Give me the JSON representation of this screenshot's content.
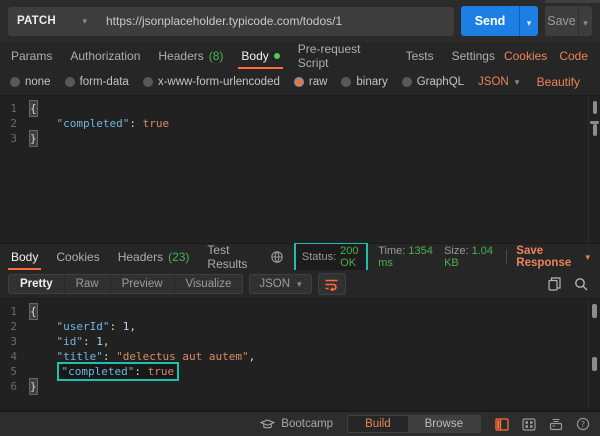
{
  "theme": {
    "accent_orange": "#ff6c37",
    "link_orange": "#ed835a",
    "success_green": "#4caf50",
    "highlight_teal": "#1dbfae",
    "send_blue": "#1d7fe4",
    "bg_dark": "#262626",
    "editor_bg": "#212121"
  },
  "request_bar": {
    "method": "PATCH",
    "url": "https://jsonplaceholder.typicode.com/todos/1",
    "send": "Send",
    "save": "Save"
  },
  "request_tabs": {
    "params": "Params",
    "authorization": "Authorization",
    "headers": "Headers",
    "headers_count": "(8)",
    "body": "Body",
    "prerequest": "Pre-request Script",
    "tests": "Tests",
    "settings": "Settings",
    "cookies": "Cookies",
    "code": "Code",
    "active_tab": "Body"
  },
  "body_options": {
    "none": "none",
    "form_data": "form-data",
    "urlencoded": "x-www-form-urlencoded",
    "raw": "raw",
    "binary": "binary",
    "graphql": "GraphQL",
    "format": "JSON",
    "beautify": "Beautify",
    "selected_mode": "raw"
  },
  "request_editor": {
    "lines": [
      {
        "num": "1",
        "tokens": [
          {
            "text": "{",
            "type": "punct"
          }
        ]
      },
      {
        "num": "2",
        "tokens": [
          {
            "text": "    ",
            "type": "ws"
          },
          {
            "text": "\"completed\"",
            "type": "key"
          },
          {
            "text": ": ",
            "type": "punct"
          },
          {
            "text": "true",
            "type": "bool"
          }
        ]
      },
      {
        "num": "3",
        "tokens": [
          {
            "text": "}",
            "type": "punct"
          }
        ]
      }
    ]
  },
  "response_tabs": {
    "body": "Body",
    "cookies": "Cookies",
    "headers": "Headers",
    "headers_count": "(23)",
    "test_results": "Test Results",
    "active_tab": "Body"
  },
  "response_meta": {
    "status_label": "Status:",
    "status_value": "200 OK",
    "time_label": "Time:",
    "time_value": "1354 ms",
    "size_label": "Size:",
    "size_value": "1.04 KB",
    "save_response": "Save Response"
  },
  "response_toolbar": {
    "pretty": "Pretty",
    "raw": "Raw",
    "preview": "Preview",
    "visualize": "Visualize",
    "format": "JSON",
    "active_view": "Pretty"
  },
  "response_editor": {
    "lines": [
      {
        "num": "1",
        "tokens": [
          {
            "text": "{",
            "type": "punct"
          }
        ]
      },
      {
        "num": "2",
        "tokens": [
          {
            "text": "    ",
            "type": "ws"
          },
          {
            "text": "\"userId\"",
            "type": "key"
          },
          {
            "text": ": ",
            "type": "punct"
          },
          {
            "text": "1",
            "type": "num"
          },
          {
            "text": ",",
            "type": "punct"
          }
        ]
      },
      {
        "num": "3",
        "tokens": [
          {
            "text": "    ",
            "type": "ws"
          },
          {
            "text": "\"id\"",
            "type": "key"
          },
          {
            "text": ": ",
            "type": "punct"
          },
          {
            "text": "1",
            "type": "num"
          },
          {
            "text": ",",
            "type": "punct"
          }
        ]
      },
      {
        "num": "4",
        "tokens": [
          {
            "text": "    ",
            "type": "ws"
          },
          {
            "text": "\"title\"",
            "type": "key"
          },
          {
            "text": ": ",
            "type": "punct"
          },
          {
            "text": "\"delectus aut autem\"",
            "type": "str"
          },
          {
            "text": ",",
            "type": "punct"
          }
        ]
      },
      {
        "num": "5",
        "highlighted": true,
        "tokens": [
          {
            "text": "    ",
            "type": "ws"
          },
          {
            "text": "\"completed\"",
            "type": "key"
          },
          {
            "text": ": ",
            "type": "punct"
          },
          {
            "text": "true",
            "type": "bool"
          }
        ]
      },
      {
        "num": "6",
        "tokens": [
          {
            "text": "}",
            "type": "punct"
          }
        ]
      }
    ]
  },
  "status_bar": {
    "bootcamp": "Bootcamp",
    "build": "Build",
    "browse": "Browse"
  }
}
